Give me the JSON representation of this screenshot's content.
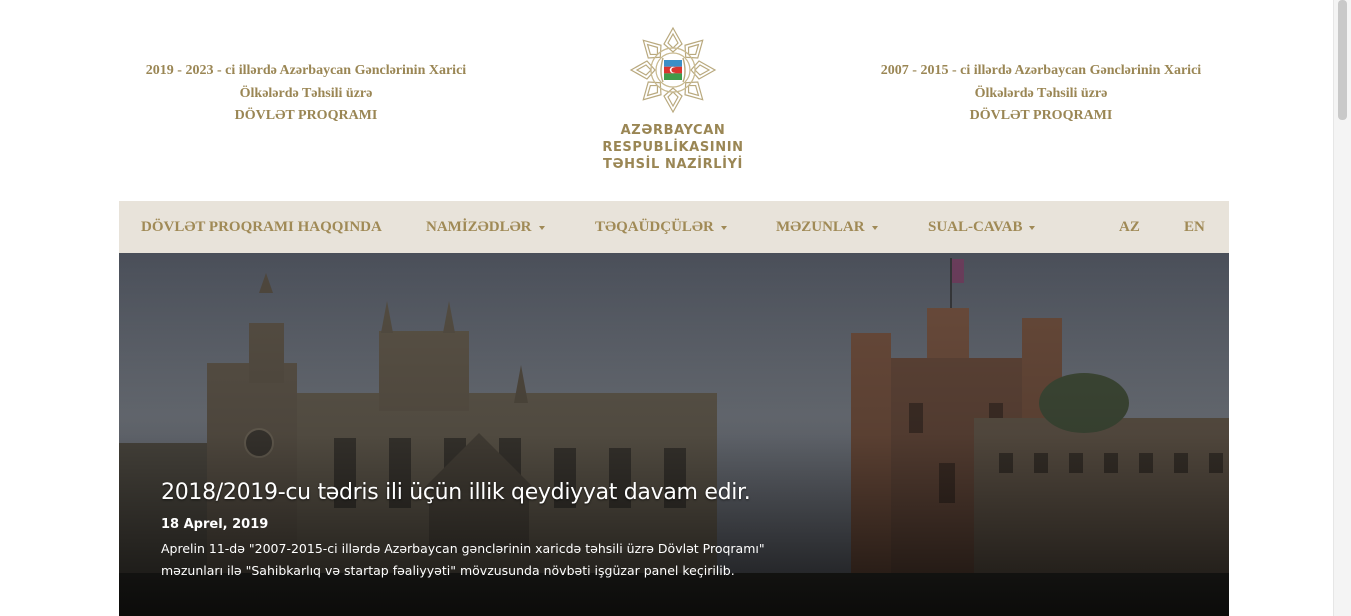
{
  "header": {
    "left_program": {
      "line1": "2019 - 2023 - ci illərdə Azərbaycan Gənclərinin Xarici",
      "line2": "Ölkələrdə Təhsili üzrə",
      "line3": "DÖVLƏT PROQRAMI"
    },
    "right_program": {
      "line1": "2007 - 2015 - ci illərdə Azərbaycan Gənclərinin Xarici",
      "line2": "Ölkələrdə Təhsili üzrə",
      "line3": "DÖVLƏT PROQRAMI"
    },
    "ministry": {
      "line1": "AZƏRBAYCAN RESPUBLİKASININ",
      "line2": "TƏHSİL NAZİRLİYİ"
    },
    "emblem_icon": "azerbaijan-state-emblem-icon",
    "brand_color": "#9a8654"
  },
  "nav": {
    "background": "#e8e3da",
    "items": [
      {
        "label": "DÖVLƏT PROQRAMI HAQQINDA",
        "dropdown": false
      },
      {
        "label": "NAMİZƏDLƏR",
        "dropdown": true
      },
      {
        "label": "TƏQAÜDÇÜLƏR",
        "dropdown": true
      },
      {
        "label": "MƏZUNLAR",
        "dropdown": true
      },
      {
        "label": "SUAL-CAVAB",
        "dropdown": true
      }
    ],
    "languages": [
      "AZ",
      "EN"
    ]
  },
  "hero": {
    "title": "2018/2019-cu tədris ili üçün illik qeydiyyat davam edir.",
    "date": "18 Aprel, 2019",
    "description_line1": "Aprelin 11-də \"2007-2015-ci illərdə Azərbaycan gənclərinin xaricdə təhsili üzrə Dövlət Proqramı\"",
    "description_line2": "məzunları ilə \"Sahibkarlıq və startap fəaliyyəti\" mövzusunda növbəti işgüzar panel keçirilib.",
    "image_icon": "university-college-photo"
  }
}
